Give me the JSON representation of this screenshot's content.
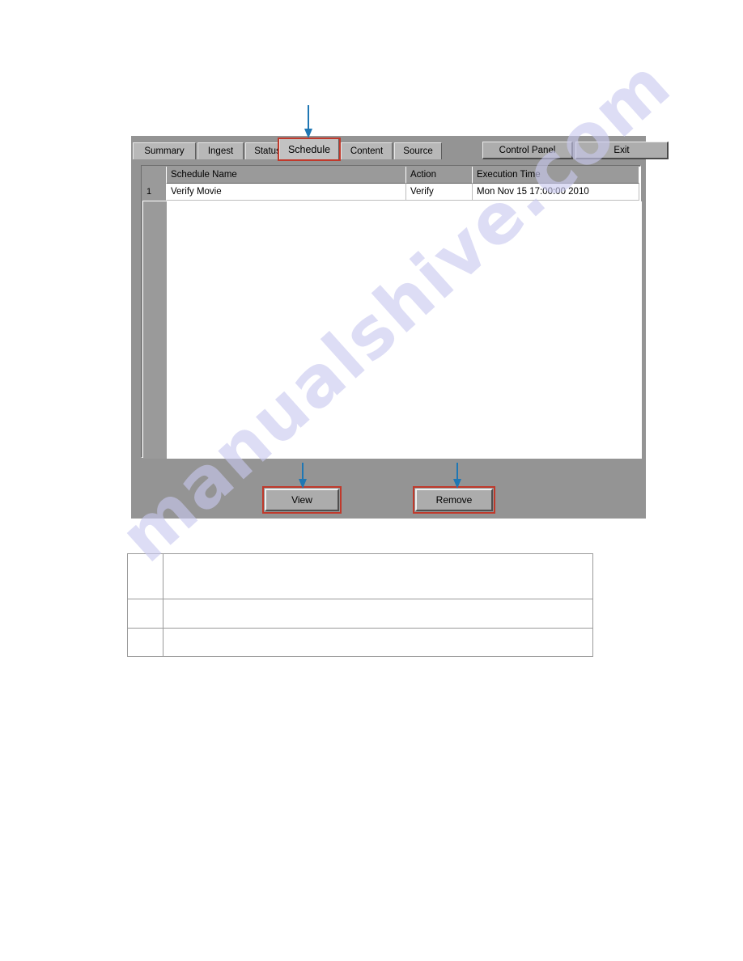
{
  "watermark": {
    "text": "manualshive.com",
    "color": "#c9c9ef"
  },
  "annotation": {
    "highlight_color": "#c0392b",
    "arrow_color": "#1f77b4"
  },
  "app": {
    "tabs": [
      {
        "label": "Summary",
        "active": false
      },
      {
        "label": "Ingest",
        "active": false
      },
      {
        "label": "Status",
        "active": false
      },
      {
        "label": "Schedule",
        "active": true
      },
      {
        "label": "Content",
        "active": false
      },
      {
        "label": "Source",
        "active": false
      }
    ],
    "window_buttons": [
      {
        "label": "Control Panel"
      },
      {
        "label": "Exit"
      }
    ],
    "table": {
      "columns": [
        "",
        "Schedule Name",
        "Action",
        "Execution Time"
      ],
      "rows": [
        {
          "num": "1",
          "schedule_name": "Verify Movie",
          "action": "Verify",
          "execution_time": "Mon Nov 15 17:00:00 2010"
        }
      ]
    },
    "actions": [
      {
        "label": "View"
      },
      {
        "label": "Remove"
      }
    ]
  },
  "legend": {
    "rows": [
      {
        "num": "",
        "text": ""
      },
      {
        "num": "",
        "text": ""
      },
      {
        "num": "",
        "text": ""
      }
    ]
  }
}
